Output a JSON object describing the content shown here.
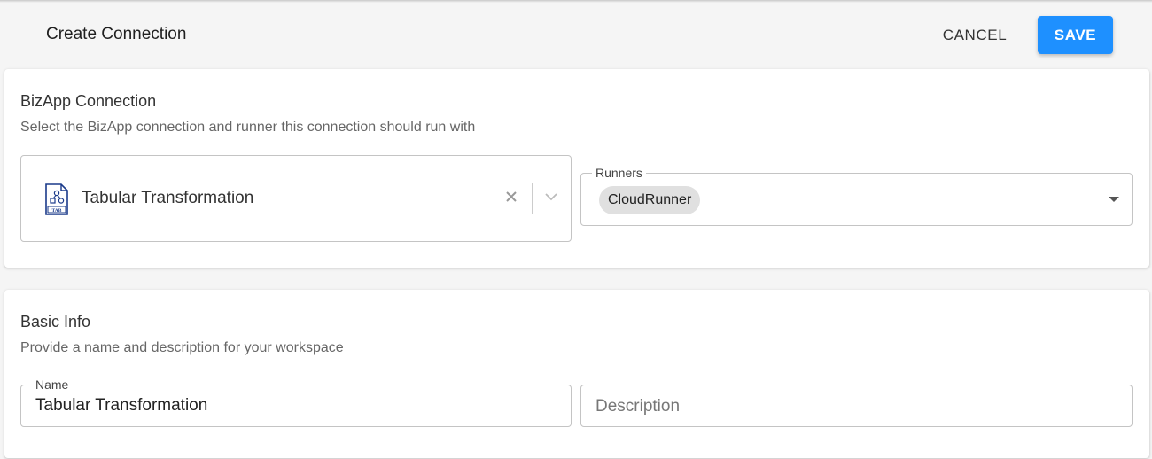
{
  "header": {
    "title": "Create Connection",
    "cancel_label": "CANCEL",
    "save_label": "SAVE"
  },
  "bizapp": {
    "title": "BizApp Connection",
    "subtitle": "Select the BizApp connection and runner this connection should run with",
    "connection": {
      "value": "Tabular Transformation",
      "icon": "tab-file-icon",
      "icon_text": "TAB"
    },
    "runners": {
      "label": "Runners",
      "chip": "CloudRunner"
    }
  },
  "basic_info": {
    "title": "Basic Info",
    "subtitle": "Provide a name and description for your workspace",
    "name": {
      "label": "Name",
      "value": "Tabular Transformation"
    },
    "description": {
      "placeholder": "Description",
      "value": ""
    }
  },
  "colors": {
    "primary": "#1e90ff",
    "icon_blue": "#1a3a8a"
  }
}
